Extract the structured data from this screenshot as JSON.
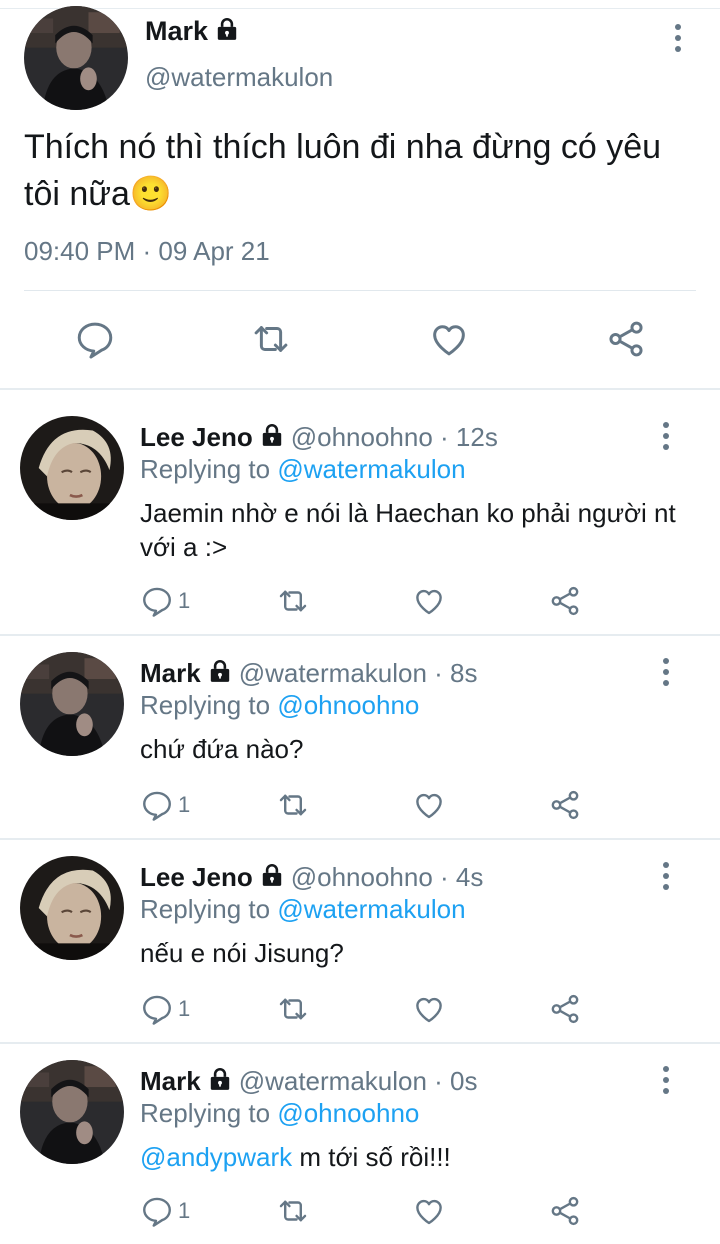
{
  "main_tweet": {
    "name": "Mark",
    "handle": "@watermakulon",
    "text": "Thích nó thì thích luôn đi nha đừng có yêu tôi nữa🙂",
    "time": "09:40 PM · 09 Apr 21"
  },
  "replying_label": "Replying to",
  "replies": [
    {
      "name": "Lee Jeno",
      "handle": "@ohnoohno · 12s",
      "reply_to": "@watermakulon",
      "text": "Jaemin nhờ e nói là Haechan ko phải người nt với a :>",
      "reply_count": "1"
    },
    {
      "name": "Mark",
      "handle": "@watermakulon · 8s",
      "reply_to": "@ohnoohno",
      "text": "chứ đứa nào?",
      "reply_count": "1"
    },
    {
      "name": "Lee Jeno",
      "handle": "@ohnoohno · 4s",
      "reply_to": "@watermakulon",
      "text": "nếu e nói Jisung?",
      "reply_count": "1"
    },
    {
      "name": "Mark",
      "handle": "@watermakulon · 0s",
      "reply_to": "@ohnoohno",
      "mention": "@andypwark",
      "text": " m tới số rồi!!!",
      "reply_count": "1"
    }
  ],
  "colors": {
    "link": "#1da1f2",
    "muted": "#657786",
    "text": "#14171a",
    "icon": "#657786"
  },
  "icons": [
    "lock-icon",
    "more-icon",
    "reply-icon",
    "retweet-icon",
    "like-icon",
    "share-icon"
  ]
}
